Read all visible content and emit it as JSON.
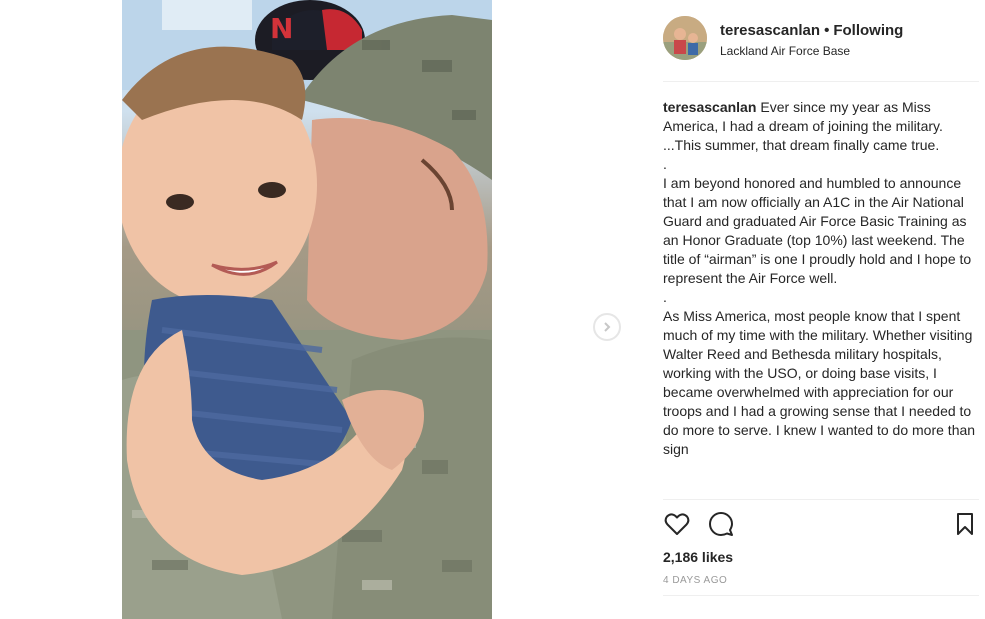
{
  "post": {
    "username": "teresascanlan",
    "separator": "•",
    "follow_status": "Following",
    "location": "Lackland Air Force Base",
    "caption": {
      "username": "teresascanlan",
      "paragraphs": [
        "Ever since my year as Miss America, I had a dream of joining the military. ...This summer, that dream finally came true.",
        ".",
        "I am beyond honored and humbled to announce that I am now officially an A1C in the Air National Guard and graduated Air Force Basic Training as an Honor Graduate (top 10%) last weekend. The title of “airman” is one I proudly hold and I hope to represent the Air Force well.",
        ".",
        "As Miss America, most people know that I spent much of my time with the military. Whether visiting Walter Reed and Bethesda military hospitals, working with the USO, or doing base visits, I became overwhelmed with appreciation for our troops and I had a growing sense that I needed to do more to serve. I knew I wanted to do more than sign"
      ]
    },
    "likes": "2,186 likes",
    "timestamp": "4 DAYS AGO"
  },
  "icons": {
    "like": "heart-icon",
    "comment": "comment-icon",
    "save": "bookmark-icon",
    "next": "chevron-right-icon"
  },
  "colors": {
    "text": "#262626",
    "muted": "#999999",
    "divider": "#efefef"
  }
}
